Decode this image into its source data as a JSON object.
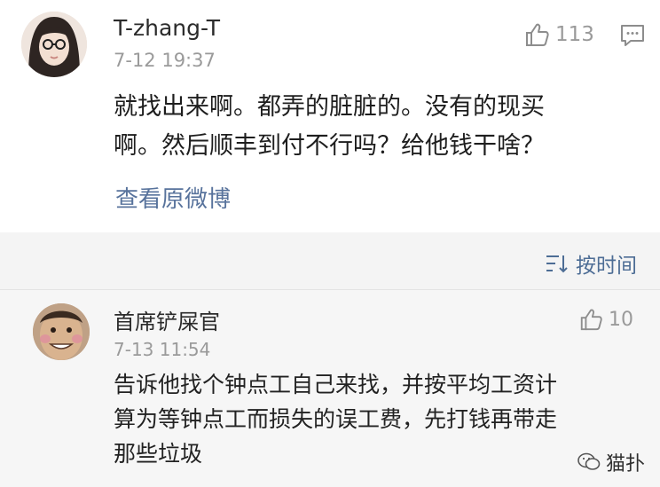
{
  "comments": [
    {
      "username": "T-zhang-T",
      "time": "7-12 19:37",
      "likes": "113",
      "text_lines": [
        "就找出来啊。都弄的脏脏的。没有的现买",
        "啊。然后顺丰到付不行吗？给他钱干啥？"
      ],
      "view_original": "查看原微博"
    },
    {
      "username": "首席铲屎官",
      "time": "7-13 11:54",
      "likes": "10",
      "text_lines": [
        "告诉他找个钟点工自己来找，并按平均工资计",
        "算为等钟点工而损失的误工费，先打钱再带走",
        "那些垃圾"
      ]
    }
  ],
  "sort": {
    "label": "按时间"
  },
  "watermark": {
    "text": "猫扑"
  },
  "colors": {
    "link": "#58739c",
    "meta": "#9a9a9a",
    "sort": "#4d6d95"
  }
}
